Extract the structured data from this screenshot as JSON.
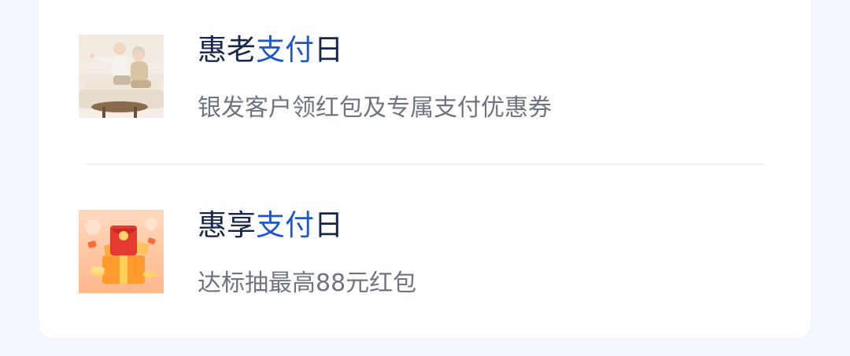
{
  "items": [
    {
      "title_prefix": "惠老",
      "title_accent": "支付",
      "title_suffix": "日",
      "subtitle": "银发客户领红包及专属支付优惠券",
      "icon": "elderly-couple-image"
    },
    {
      "title_prefix": "惠享",
      "title_accent": "支付",
      "title_suffix": "日",
      "subtitle": "达标抽最高88元红包",
      "icon": "red-envelope-gift-image"
    }
  ],
  "colors": {
    "title": "#16264a",
    "accent": "#1f56c9",
    "subtitle": "#6f7480",
    "background": "#f3f6fc",
    "card": "#ffffff"
  }
}
